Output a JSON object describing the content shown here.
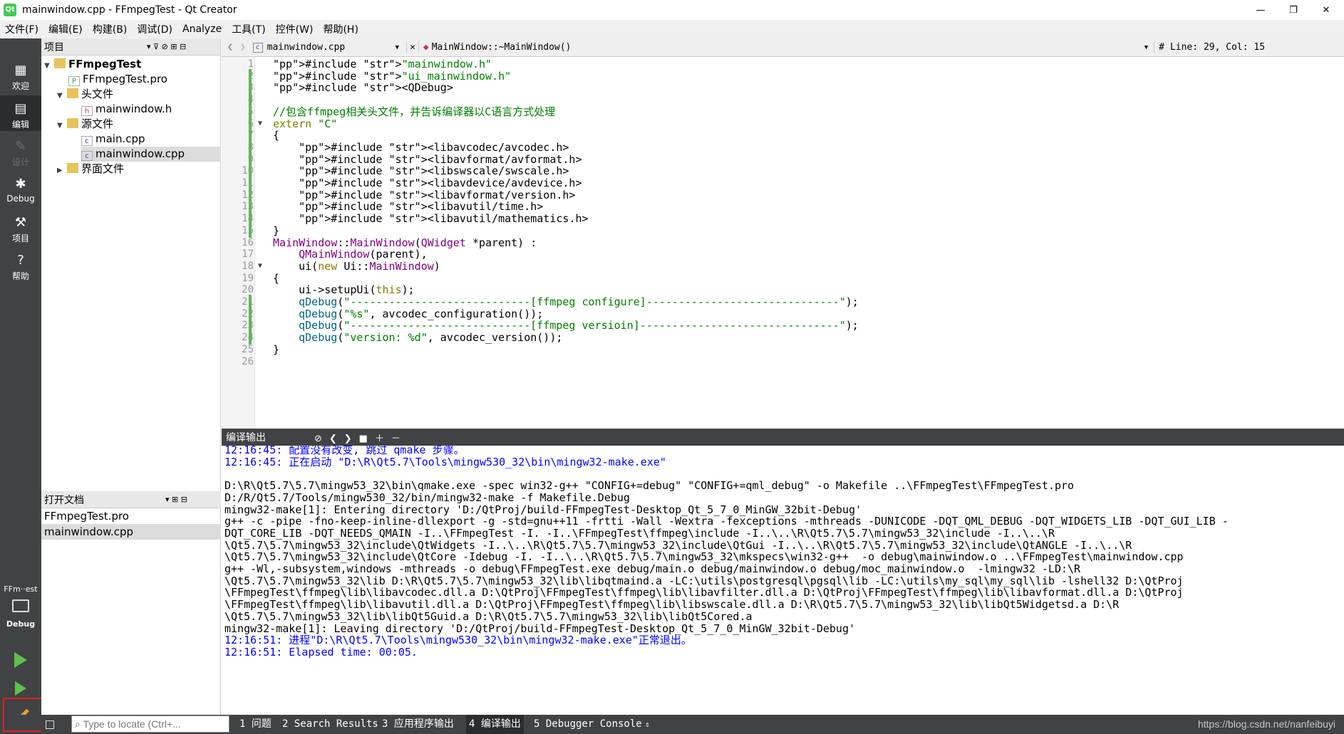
{
  "window": {
    "title": "mainwindow.cpp - FFmpegTest - Qt Creator",
    "minimize": "—",
    "restore": "❐",
    "close": "✕"
  },
  "menu": [
    "文件(F)",
    "编辑(E)",
    "构建(B)",
    "调试(D)",
    "Analyze",
    "工具(T)",
    "控件(W)",
    "帮助(H)"
  ],
  "modes": [
    {
      "label": "欢迎",
      "icon": "grid-icon"
    },
    {
      "label": "编辑",
      "icon": "edit-icon"
    },
    {
      "label": "设计",
      "icon": "pencil-icon"
    },
    {
      "label": "Debug",
      "icon": "bug-icon"
    },
    {
      "label": "项目",
      "icon": "wrench-icon"
    },
    {
      "label": "帮助",
      "icon": "help-icon"
    }
  ],
  "kit": {
    "project": "FFm··est",
    "config": "Debug"
  },
  "projects_pane": {
    "title": "项目",
    "tree": [
      {
        "label": "FFmpegTest",
        "bold": true
      },
      {
        "label": "FFmpegTest.pro"
      },
      {
        "label": "头文件"
      },
      {
        "label": "mainwindow.h"
      },
      {
        "label": "源文件"
      },
      {
        "label": "main.cpp"
      },
      {
        "label": "mainwindow.cpp",
        "selected": true
      },
      {
        "label": "界面文件"
      }
    ]
  },
  "open_docs": {
    "title": "打开文档",
    "items": [
      "FFmpegTest.pro",
      "mainwindow.cpp"
    ]
  },
  "editor": {
    "file": "mainwindow.cpp",
    "symbol": "MainWindow::~MainWindow()",
    "position": "Line: 29, Col: 15",
    "hash": "#",
    "lines": [
      "#include \"mainwindow.h\"",
      "#include \"ui_mainwindow.h\"",
      "#include <QDebug>",
      "",
      "//包含ffmpeg相关头文件，并告诉编译器以C语言方式处理",
      "extern \"C\"",
      "{",
      "    #include <libavcodec/avcodec.h>",
      "    #include <libavformat/avformat.h>",
      "    #include <libswscale/swscale.h>",
      "    #include <libavdevice/avdevice.h>",
      "    #include <libavformat/version.h>",
      "    #include <libavutil/time.h>",
      "    #include <libavutil/mathematics.h>",
      "}",
      "MainWindow::MainWindow(QWidget *parent) :",
      "    QMainWindow(parent),",
      "    ui(new Ui::MainWindow)",
      "{",
      "    ui->setupUi(this);",
      "    qDebug(\"----------------------------[ffmpeg configure]------------------------------\");",
      "    qDebug(\"%s\", avcodec_configuration());",
      "    qDebug(\"----------------------------[ffmpeg versioin]-------------------------------\");",
      "    qDebug(\"version: %d\", avcodec_version());",
      "}",
      ""
    ]
  },
  "output": {
    "title": "编译输出",
    "lines": [
      {
        "text": "12:16:45: 配置没有改变, 跳过 qmake 步骤。",
        "blue": true
      },
      {
        "text": "12:16:45: 正在启动 \"D:\\R\\Qt5.7\\Tools\\mingw530_32\\bin\\mingw32-make.exe\"",
        "blue": true
      },
      {
        "text": ""
      },
      {
        "text": "D:\\R\\Qt5.7\\5.7\\mingw53_32\\bin\\qmake.exe -spec win32-g++ \"CONFIG+=debug\" \"CONFIG+=qml_debug\" -o Makefile ..\\FFmpegTest\\FFmpegTest.pro"
      },
      {
        "text": "D:/R/Qt5.7/Tools/mingw530_32/bin/mingw32-make -f Makefile.Debug"
      },
      {
        "text": "mingw32-make[1]: Entering directory 'D:/QtProj/build-FFmpegTest-Desktop_Qt_5_7_0_MinGW_32bit-Debug'"
      },
      {
        "text": "g++ -c -pipe -fno-keep-inline-dllexport -g -std=gnu++11 -frtti -Wall -Wextra -fexceptions -mthreads -DUNICODE -DQT_QML_DEBUG -DQT_WIDGETS_LIB -DQT_GUI_LIB -"
      },
      {
        "text": "DQT_CORE_LIB -DQT_NEEDS_QMAIN -I..\\FFmpegTest -I. -I..\\FFmpegTest\\ffmpeg\\include -I..\\..\\R\\Qt5.7\\5.7\\mingw53_32\\include -I..\\..\\R"
      },
      {
        "text": "\\Qt5.7\\5.7\\mingw53_32\\include\\QtWidgets -I..\\..\\R\\Qt5.7\\5.7\\mingw53_32\\include\\QtGui -I..\\..\\R\\Qt5.7\\5.7\\mingw53_32\\include\\QtANGLE -I..\\..\\R"
      },
      {
        "text": "\\Qt5.7\\5.7\\mingw53_32\\include\\QtCore -Idebug -I. -I..\\..\\R\\Qt5.7\\5.7\\mingw53_32\\mkspecs\\win32-g++  -o debug\\mainwindow.o ..\\FFmpegTest\\mainwindow.cpp"
      },
      {
        "text": "g++ -Wl,-subsystem,windows -mthreads -o debug\\FFmpegTest.exe debug/main.o debug/mainwindow.o debug/moc_mainwindow.o  -lmingw32 -LD:\\R"
      },
      {
        "text": "\\Qt5.7\\5.7\\mingw53_32\\lib D:\\R\\Qt5.7\\5.7\\mingw53_32\\lib\\libqtmaind.a -LC:\\utils\\postgresql\\pgsql\\lib -LC:\\utils\\my_sql\\my_sql\\lib -lshell32 D:\\QtProj"
      },
      {
        "text": "\\FFmpegTest\\ffmpeg\\lib\\libavcodec.dll.a D:\\QtProj\\FFmpegTest\\ffmpeg\\lib\\libavfilter.dll.a D:\\QtProj\\FFmpegTest\\ffmpeg\\lib\\libavformat.dll.a D:\\QtProj"
      },
      {
        "text": "\\FFmpegTest\\ffmpeg\\lib\\libavutil.dll.a D:\\QtProj\\FFmpegTest\\ffmpeg\\lib\\libswscale.dll.a D:\\R\\Qt5.7\\5.7\\mingw53_32\\lib\\libQt5Widgetsd.a D:\\R"
      },
      {
        "text": "\\Qt5.7\\5.7\\mingw53_32\\lib\\libQt5Guid.a D:\\R\\Qt5.7\\5.7\\mingw53_32\\lib\\libQt5Cored.a"
      },
      {
        "text": "mingw32-make[1]: Leaving directory 'D:/QtProj/build-FFmpegTest-Desktop_Qt_5_7_0_MinGW_32bit-Debug'"
      },
      {
        "text": "12:16:51: 进程\"D:\\R\\Qt5.7\\Tools\\mingw530_32\\bin\\mingw32-make.exe\"正常退出。",
        "blue": true
      },
      {
        "text": "12:16:51: Elapsed time: 00:05.",
        "blue": true
      }
    ]
  },
  "statusbar": {
    "locator_placeholder": "Type to locate (Ctrl+...",
    "tabs": [
      "1 问题",
      "2 Search Results",
      "3 应用程序输出",
      "4 编译输出",
      "5 Debugger Console"
    ],
    "active_tab": 3
  },
  "annotation": "编译",
  "watermark": "https://blog.csdn.net/nanfeibuyi",
  "colors": {
    "mode_bar": "#404244",
    "annotation": "#e02020",
    "keyword": "#808000",
    "string": "#008000",
    "preprocessor": "#000080"
  }
}
